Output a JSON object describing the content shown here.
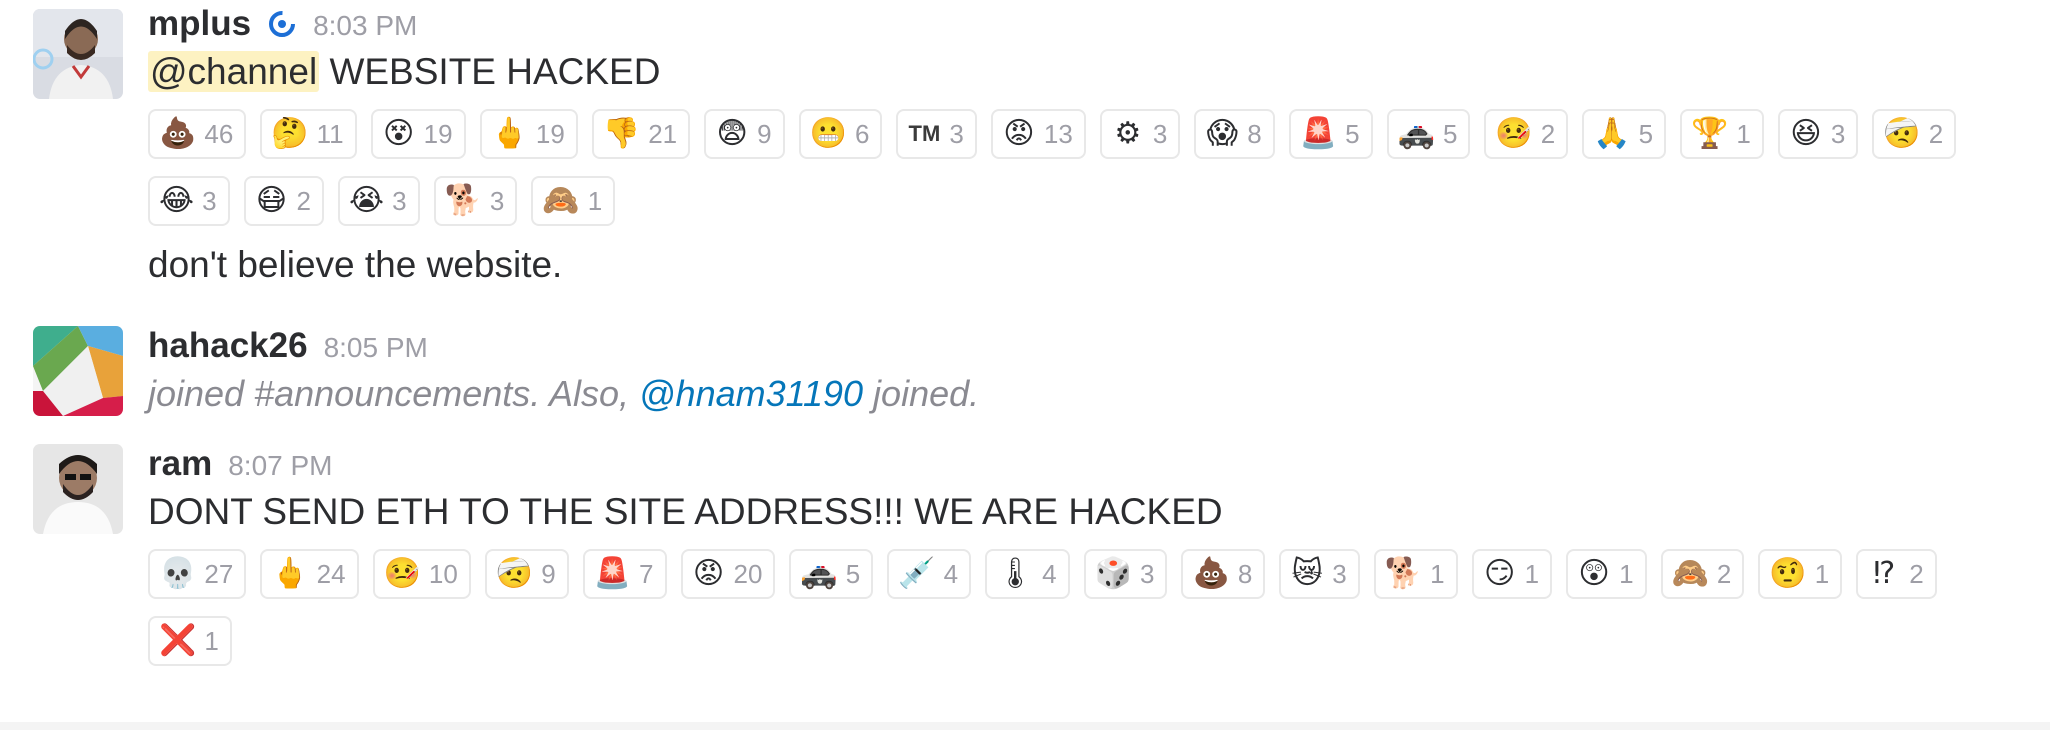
{
  "messages": [
    {
      "user": "mplus",
      "time": "8:03 PM",
      "mention": "@channel",
      "text": " WEBSITE HACKED",
      "followup": "don't believe the website.",
      "reactions": [
        {
          "emoji": "💩",
          "name": "poop-icon",
          "count": "46"
        },
        {
          "emoji": "🤔",
          "name": "thinking-face-icon",
          "count": "11"
        },
        {
          "emoji": "😵",
          "name": "dizzy-face-icon",
          "count": "19"
        },
        {
          "emoji": "🖕",
          "name": "middle-finger-icon",
          "count": "19"
        },
        {
          "emoji": "👎",
          "name": "thumbs-down-icon",
          "count": "21"
        },
        {
          "emoji": "😨",
          "name": "fearful-face-icon",
          "count": "9"
        },
        {
          "emoji": "😬",
          "name": "grimacing-face-icon",
          "count": "6"
        },
        {
          "emoji": "TM",
          "name": "trademark-icon",
          "count": "3"
        },
        {
          "emoji": "😡",
          "name": "angry-face-icon",
          "count": "13"
        },
        {
          "emoji": "⚙",
          "name": "gear-icon",
          "count": "3"
        },
        {
          "emoji": "😱",
          "name": "screaming-face-icon",
          "count": "8"
        },
        {
          "emoji": "🚨",
          "name": "rotating-light-icon",
          "count": "5"
        },
        {
          "emoji": "🚓",
          "name": "police-car-icon",
          "count": "5"
        },
        {
          "emoji": "🤒",
          "name": "sick-face-icon",
          "count": "2"
        },
        {
          "emoji": "🙏",
          "name": "folded-hands-icon",
          "count": "5"
        },
        {
          "emoji": "🏆",
          "name": "trophy-icon",
          "count": "1"
        },
        {
          "emoji": "😆",
          "name": "laughing-face-icon",
          "count": "3"
        },
        {
          "emoji": "🤕",
          "name": "bandaged-face-icon",
          "count": "2"
        },
        {
          "emoji": "😂",
          "name": "tears-of-joy-icon",
          "count": "3"
        },
        {
          "emoji": "😷",
          "name": "mask-face-icon",
          "count": "2"
        },
        {
          "emoji": "😭",
          "name": "crying-face-icon",
          "count": "3"
        },
        {
          "emoji": "🐕",
          "name": "this-is-fine-dog-icon",
          "count": "3"
        },
        {
          "emoji": "🙈",
          "name": "custom-emoji-icon",
          "count": "1"
        }
      ]
    },
    {
      "user": "hahack26",
      "time": "8:05 PM",
      "system_a": "joined #announcements. Also, ",
      "system_link": "@hnam31190",
      "system_b": " joined."
    },
    {
      "user": "ram",
      "time": "8:07 PM",
      "text": "DONT SEND ETH TO THE SITE ADDRESS!!! WE ARE HACKED",
      "reactions": [
        {
          "emoji": "💀",
          "name": "skull-icon",
          "count": "27"
        },
        {
          "emoji": "🖕",
          "name": "middle-finger-icon",
          "count": "24"
        },
        {
          "emoji": "🤒",
          "name": "sick-face-icon",
          "count": "10"
        },
        {
          "emoji": "🤕",
          "name": "bandaged-face-icon",
          "count": "9"
        },
        {
          "emoji": "🚨",
          "name": "rotating-light-icon",
          "count": "7"
        },
        {
          "emoji": "😡",
          "name": "angry-face-icon",
          "count": "20"
        },
        {
          "emoji": "🚓",
          "name": "police-car-icon",
          "count": "5"
        },
        {
          "emoji": "💉",
          "name": "syringe-icon",
          "count": "4"
        },
        {
          "emoji": "🌡",
          "name": "thermometer-icon",
          "count": "4"
        },
        {
          "emoji": "🎲",
          "name": "game-die-icon",
          "count": "3"
        },
        {
          "emoji": "💩",
          "name": "poop-icon",
          "count": "8"
        },
        {
          "emoji": "😿",
          "name": "crying-cat-icon",
          "count": "3"
        },
        {
          "emoji": "🐕",
          "name": "this-is-fine-dog-icon",
          "count": "1"
        },
        {
          "emoji": "😏",
          "name": "trollface-icon",
          "count": "1"
        },
        {
          "emoji": "😲",
          "name": "astonished-face-icon",
          "count": "1"
        },
        {
          "emoji": "🙈",
          "name": "custom-emoji-icon",
          "count": "2"
        },
        {
          "emoji": "🤨",
          "name": "raised-eyebrow-face-icon",
          "count": "1"
        },
        {
          "emoji": "⁉",
          "name": "exclamation-question-icon",
          "count": "2"
        },
        {
          "emoji": "❌",
          "name": "cross-mark-icon",
          "count": "1"
        }
      ]
    }
  ],
  "colors": {
    "mention_bg": "#fdf2c2",
    "link": "#0576b9",
    "timestamp": "#9e9ea6",
    "verified": "#1d6fd6"
  }
}
